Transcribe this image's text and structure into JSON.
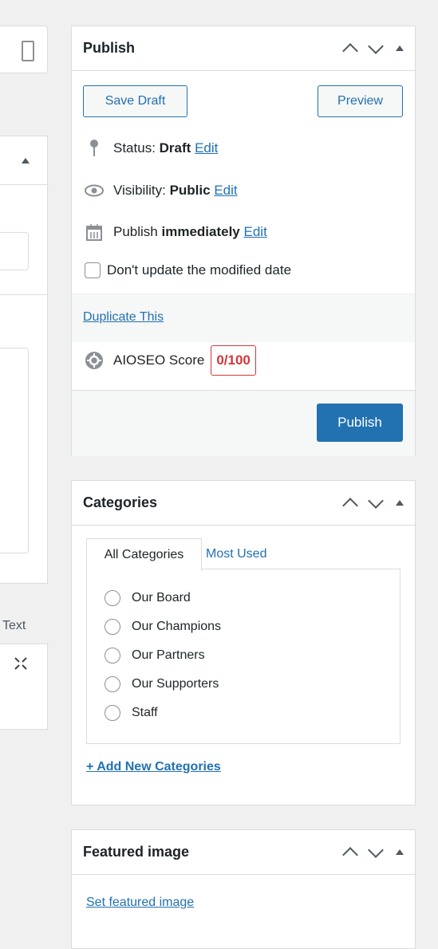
{
  "left": {
    "text_tab": "Text"
  },
  "publish": {
    "title": "Publish",
    "save_draft": "Save Draft",
    "preview": "Preview",
    "status_label": "Status:",
    "status_value": "Draft",
    "visibility_label": "Visibility:",
    "visibility_value": "Public",
    "publish_label": "Publish",
    "publish_value": "immediately",
    "edit": "Edit",
    "dont_update": "Don't update the modified date",
    "duplicate": "Duplicate This",
    "aioseo_label": "AIOSEO Score",
    "aioseo_score": "0/100",
    "publish_button": "Publish"
  },
  "categories": {
    "title": "Categories",
    "tab_all": "All Categories",
    "tab_most_used": "Most Used",
    "items": [
      "Our Board",
      "Our Champions",
      "Our Partners",
      "Our Supporters",
      "Staff"
    ],
    "add_new": "+ Add New Categories"
  },
  "featured": {
    "title": "Featured image",
    "set_link": "Set featured image"
  },
  "colors": {
    "accent": "#2271b1",
    "danger": "#d63638"
  },
  "icons": [
    "pin-icon",
    "eye-icon",
    "calendar-icon",
    "aioseo-gear-icon",
    "expand-icon",
    "columns-icon"
  ]
}
